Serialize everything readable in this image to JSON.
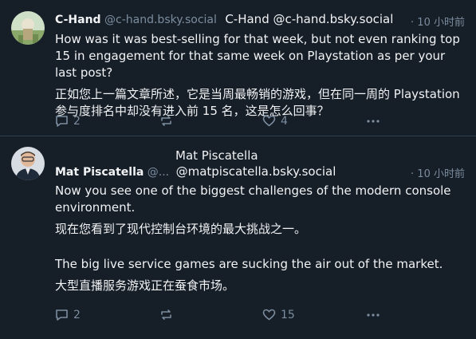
{
  "posts": [
    {
      "display_name": "C-Hand",
      "handle": "@c-hand.bsky.social",
      "overlay_label": "C-Hand @c-hand.bsky.social",
      "time": "· 10 小时前",
      "text_en": "How was it was best-selling for that week, but not even ranking top 15 in engagement for that same week on Playstation as per your last post?",
      "text_zh": "正如您上一篇文章所述，它是当周最畅销的游戏，但在同一周的 Playstation 参与度排名中却没有进入前 15 名，这是怎么回事？",
      "replies": "2",
      "likes": "4"
    },
    {
      "display_name": "Mat Piscatella",
      "handle": "@...",
      "overlay_name": "Mat Piscatella",
      "overlay_handle": "@matpiscatella.bsky.social",
      "time": "· 10 小时前",
      "para1_en": "Now you see one of the biggest challenges of the modern console environment.",
      "para1_zh": "现在您看到了现代控制台环境的最大挑战之一。",
      "para2_en": "The big live service games are sucking the air out of the market.",
      "para2_zh": "大型直播服务游戏正在蚕食市场。",
      "replies": "2",
      "likes": "15"
    }
  ],
  "icons": [
    "reply-icon",
    "repost-icon",
    "like-icon",
    "more-icon"
  ],
  "colors": {
    "background": "#161e27",
    "muted": "#7b8d9f",
    "text": "#f1f3f5"
  }
}
